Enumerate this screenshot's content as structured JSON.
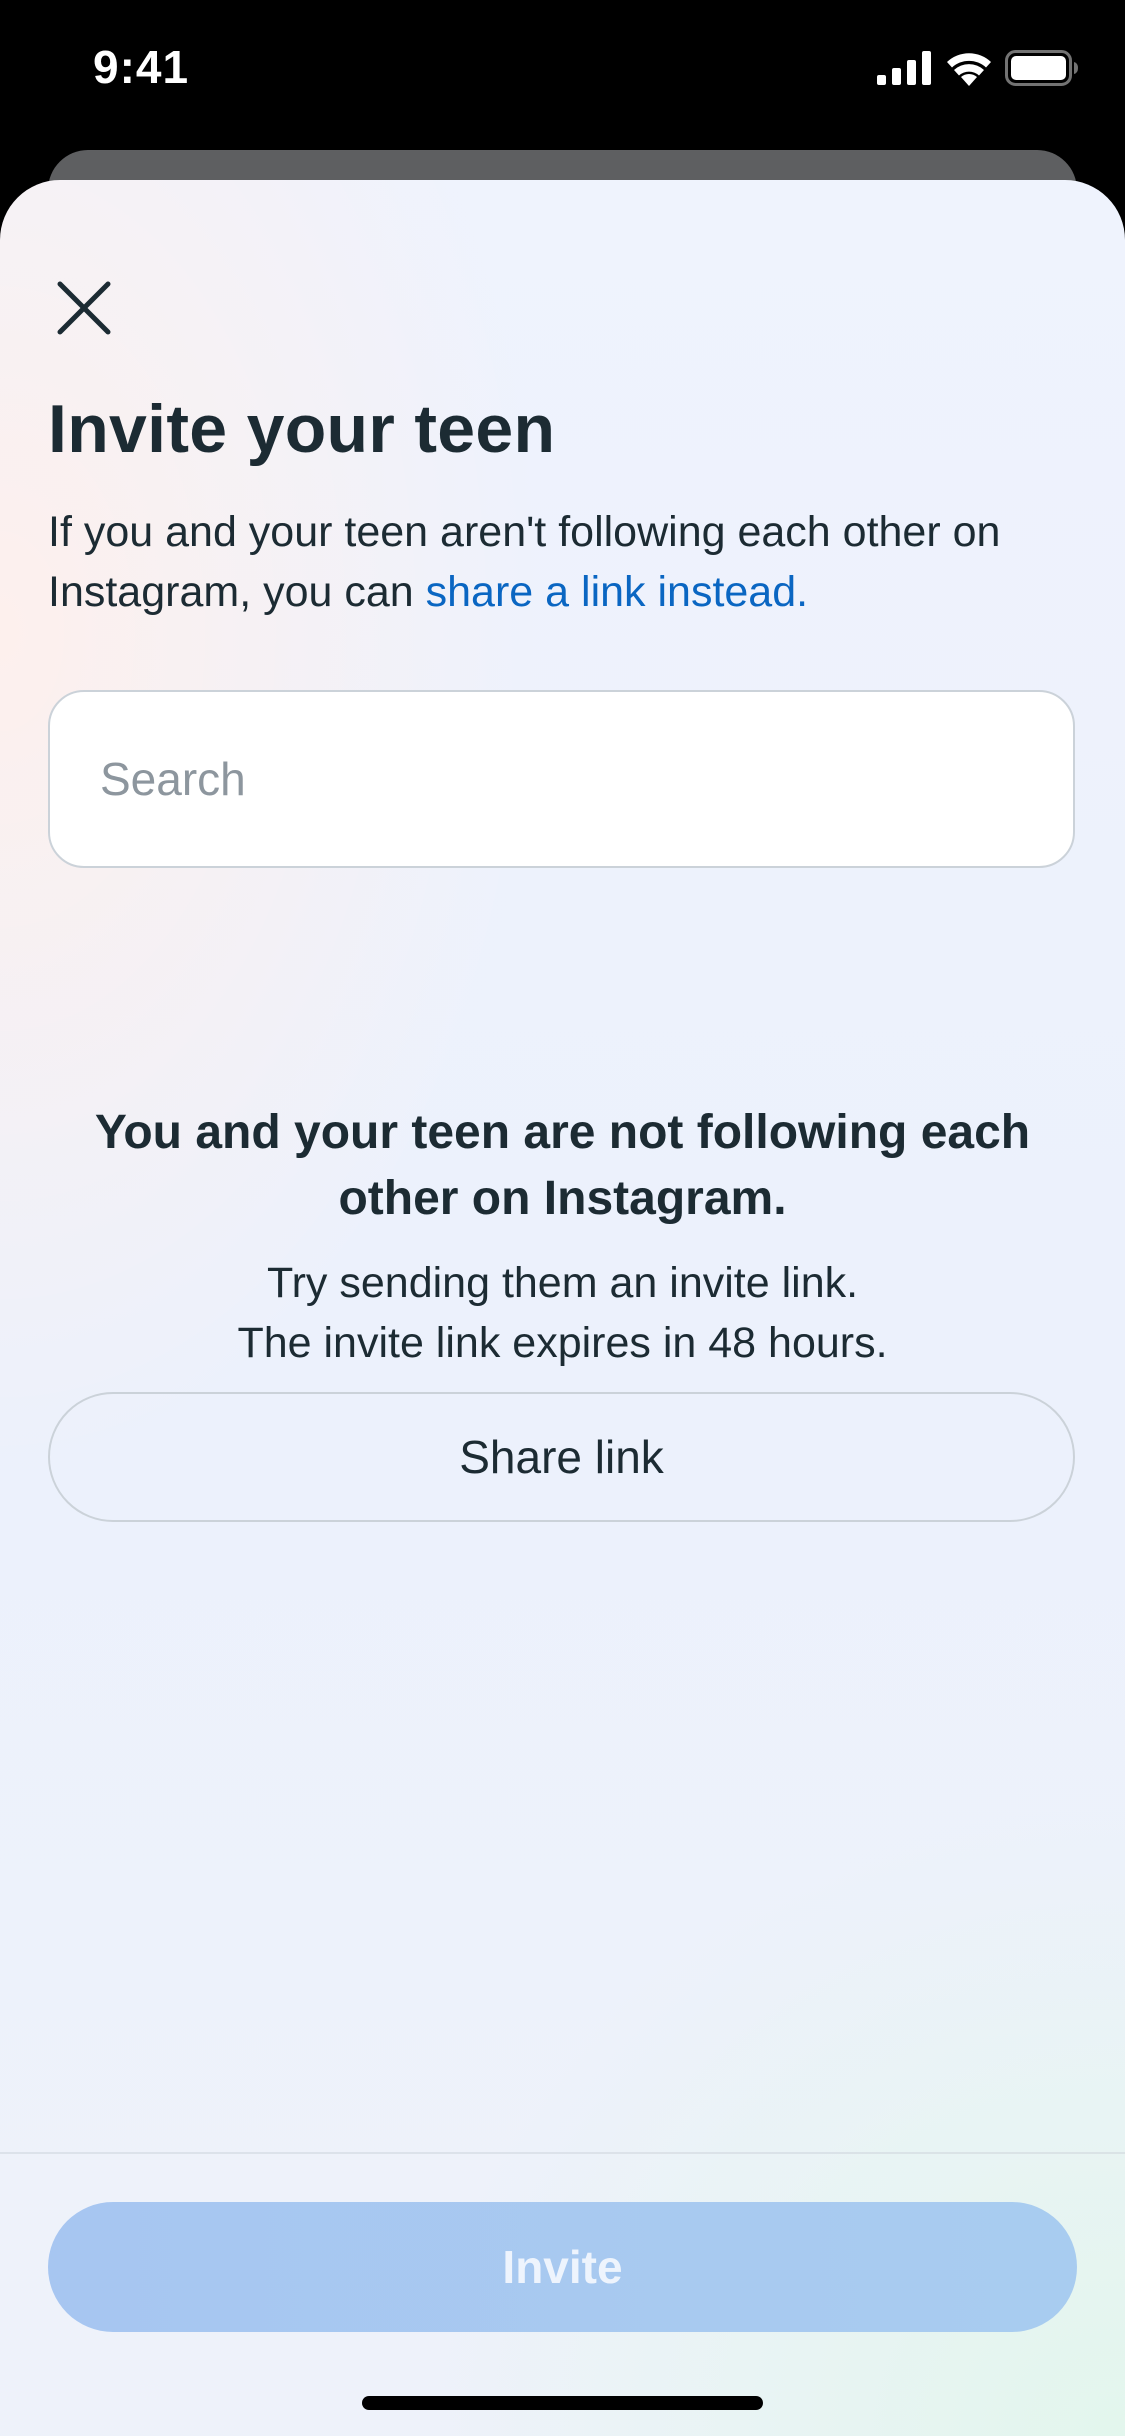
{
  "status_bar": {
    "time": "9:41"
  },
  "icons": {
    "signal": "cellular-signal-icon",
    "wifi": "wifi-icon",
    "battery": "battery-icon",
    "close": "close-icon"
  },
  "header": {
    "title": "Invite your teen",
    "description_prefix": "If you and your teen aren't following each other on Instagram, you can ",
    "description_link": "share a link instead."
  },
  "search": {
    "placeholder": "Search",
    "value": ""
  },
  "empty_state": {
    "heading": "You and your teen are not following each other on Instagram.",
    "line1": "Try sending them an invite link.",
    "line2": "The invite link expires in 48 hours.",
    "share_button": "Share link"
  },
  "footer": {
    "invite_button": "Invite",
    "invite_button_color": "#a7c6f1"
  },
  "colors": {
    "link": "#0a66c2",
    "text_primary": "#1c2b33",
    "placeholder": "#8d969e",
    "border": "#cbd2d9"
  }
}
